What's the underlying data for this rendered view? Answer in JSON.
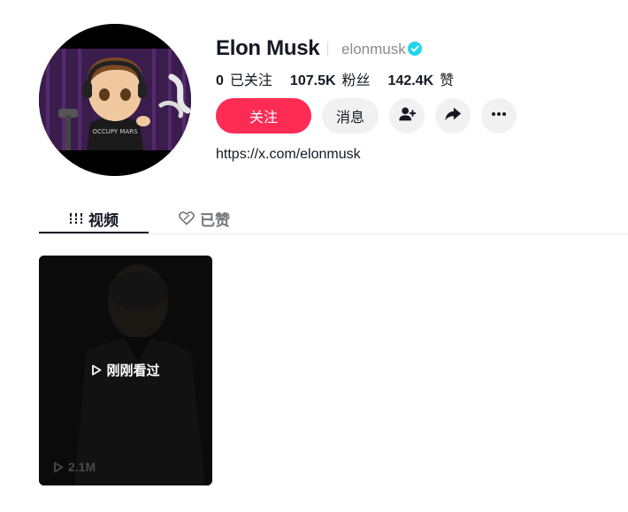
{
  "profile": {
    "display_name": "Elon Musk",
    "username": "elonmusk",
    "verified": true,
    "link": "https://x.com/elonmusk",
    "avatar_shirt_text": "OCCUPY MARS"
  },
  "stats": [
    {
      "value": "0",
      "label": "已关注"
    },
    {
      "value": "107.5K",
      "label": "粉丝"
    },
    {
      "value": "142.4K",
      "label": "赞"
    }
  ],
  "actions": {
    "follow_label": "关注",
    "message_label": "消息",
    "add_user_icon": "add-user-icon",
    "share_icon": "share-icon",
    "more_icon": "more-icon"
  },
  "tabs": [
    {
      "label": "视频",
      "icon": "grid-bars-icon",
      "active": true
    },
    {
      "label": "已赞",
      "icon": "heart-outline-icon",
      "active": false
    }
  ],
  "videos": [
    {
      "overlay_label": "刚刚看过",
      "views": "2.1M"
    }
  ],
  "colors": {
    "accent": "#fe2c55",
    "verified": "#20d5ec",
    "text": "#161823",
    "muted": "#8a8b91",
    "button_bg": "#f1f1f2"
  }
}
